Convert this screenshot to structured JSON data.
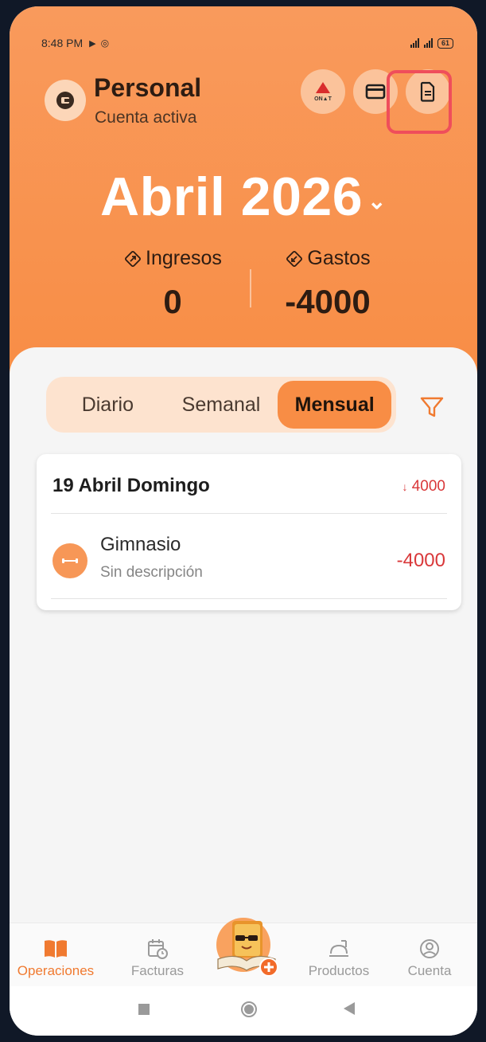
{
  "status_bar": {
    "time": "8:48 PM",
    "battery": "61"
  },
  "account": {
    "name": "Personal",
    "subtitle": "Cuenta activa",
    "icon": "wallet-icon"
  },
  "header_actions": [
    {
      "name": "ona-t-button",
      "label": "ON▲T"
    },
    {
      "name": "card-button",
      "icon": "credit-card-icon"
    },
    {
      "name": "report-button",
      "icon": "document-icon"
    }
  ],
  "period": {
    "label": "Abril 2026"
  },
  "summary": {
    "income_label": "Ingresos",
    "income_value": "0",
    "expense_label": "Gastos",
    "expense_value": "-4000"
  },
  "tabs": {
    "daily": "Diario",
    "weekly": "Semanal",
    "monthly": "Mensual",
    "active": "monthly"
  },
  "day_group": {
    "date": "19 Abril Domingo",
    "total": "4000",
    "transactions": [
      {
        "name": "Gimnasio",
        "description": "Sin descripción",
        "amount": "-4000",
        "icon": "dumbbell-icon"
      }
    ]
  },
  "bottom_nav": {
    "operations": "Operaciones",
    "invoices": "Facturas",
    "products": "Productos",
    "account": "Cuenta",
    "active": "operations"
  },
  "colors": {
    "accent": "#F88D45",
    "negative": "#D9383A",
    "highlight": "#EF4E5B"
  }
}
